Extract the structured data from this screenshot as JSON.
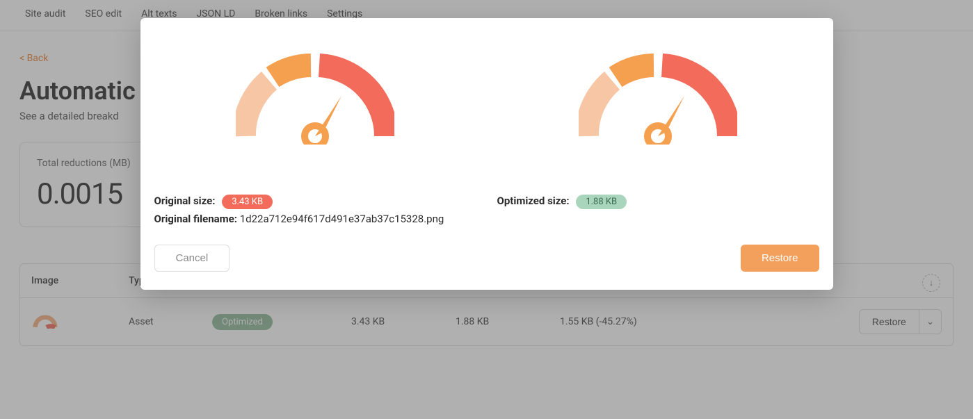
{
  "nav": {
    "items": [
      "Site audit",
      "SEO edit",
      "Alt texts",
      "JSON LD",
      "Broken links",
      "Settings"
    ]
  },
  "back_label": "< Back",
  "page_title": "Automatic i",
  "subtitle": "See a detailed breakd",
  "stat": {
    "label": "Total reductions (MB)",
    "value": "0.0015"
  },
  "table": {
    "headers": [
      "Image",
      "Typ"
    ],
    "row": {
      "type": "Asset",
      "status": "Optimized",
      "original": "3.43 KB",
      "optimized": "1.88 KB",
      "reduction": "1.55 KB (-45.27%)",
      "restore_label": "Restore"
    }
  },
  "modal": {
    "original_label": "Original size:",
    "original_value": "3.43 KB",
    "optimized_label": "Optimized size:",
    "optimized_value": "1.88 KB",
    "filename_label": "Original filename:",
    "filename_value": "1d22a712e94f617d491e37ab37c15328.png",
    "cancel": "Cancel",
    "restore": "Restore"
  }
}
